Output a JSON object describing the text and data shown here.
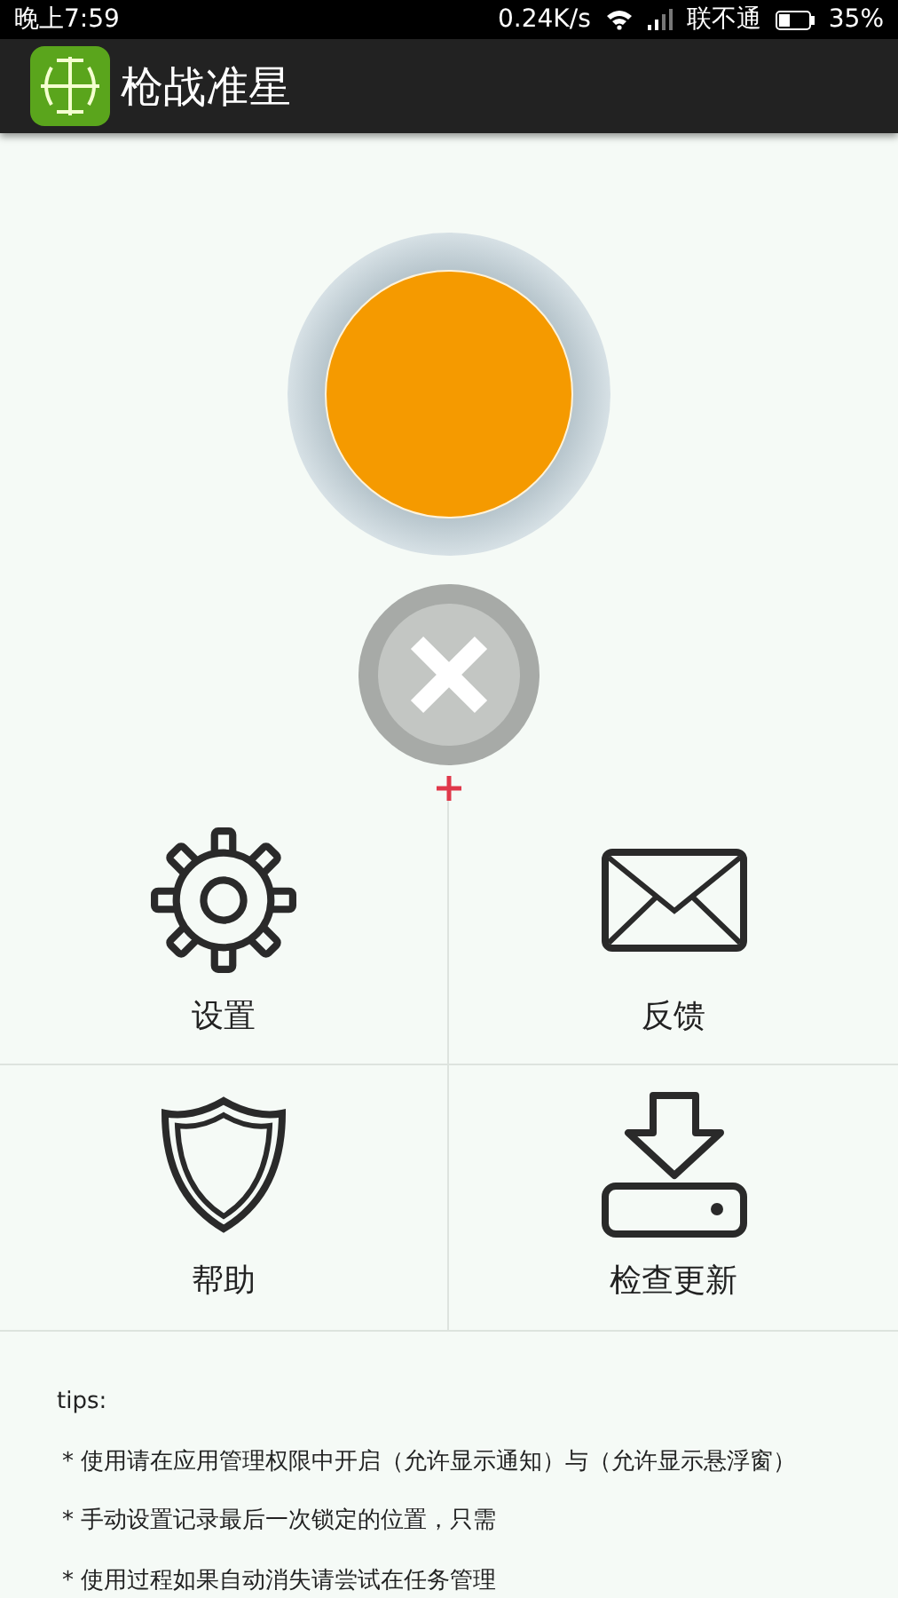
{
  "status_bar": {
    "time": "晚上7:59",
    "speed": "0.24K/s",
    "carrier": "联不通",
    "battery": "35%"
  },
  "app_bar": {
    "title": "枪战准星"
  },
  "grid": [
    {
      "kind": "settings",
      "label": "设置"
    },
    {
      "kind": "feedback",
      "label": "反馈"
    },
    {
      "kind": "help",
      "label": "帮助"
    },
    {
      "kind": "update",
      "label": "检查更新"
    }
  ],
  "tips": {
    "heading": "tips:",
    "lines": [
      "* 使用请在应用管理权限中开启（允许显示通知）与（允许显示悬浮窗）",
      "* 手动设置记录最后一次锁定的位置，只需",
      "* 使用过程如果自动消失请尝试在任务管理"
    ]
  }
}
